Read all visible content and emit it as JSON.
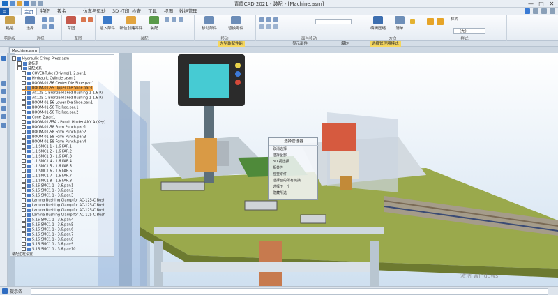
{
  "window": {
    "title": "青霞CAD 2021 - 装配 - [Machine.asm]",
    "controls": [
      "—",
      "□",
      "✕"
    ]
  },
  "menu_tabs": [
    {
      "label": "主页",
      "active": true
    },
    {
      "label": "特征",
      "active": false
    },
    {
      "label": "钣金",
      "active": false
    },
    {
      "label": "仿真与运动",
      "active": false
    },
    {
      "label": "3D 打印",
      "active": false
    },
    {
      "label": "检查",
      "active": false
    },
    {
      "label": "工具",
      "active": false
    },
    {
      "label": "视图",
      "active": false
    },
    {
      "label": "数据管理",
      "active": false
    }
  ],
  "ribbon": {
    "groups": [
      {
        "label": "剪贴板",
        "buttons": [
          "粘贴"
        ]
      },
      {
        "label": "选择",
        "buttons": [
          "选择"
        ]
      },
      {
        "label": "草图",
        "buttons": [
          "草图"
        ]
      },
      {
        "label": "装配",
        "buttons": [
          "插入部件",
          "新位创建零件",
          "装配"
        ]
      },
      {
        "label": "移动",
        "buttons": [
          "移动部件",
          "替换零件"
        ]
      },
      {
        "label": "面与移动",
        "buttons": []
      },
      {
        "label": "方向",
        "buttons": [
          "编辑压缩",
          "清单"
        ]
      },
      {
        "label": "样式",
        "buttons": [
          "样式"
        ]
      }
    ],
    "style_combo": "(无)"
  },
  "toolrow": {
    "items": [
      "大型装配性能",
      "显示部件",
      "爆炸",
      "选择管理器模式"
    ]
  },
  "document_tab": "Machine.asm",
  "tree": {
    "rows": [
      "Hydraulic Crimp Press.asm",
      "坐标系",
      "装配关系",
      "COVER-Tube (Driving(1_2.par:1",
      "Hydraulic Cylinder.asm:1",
      "BOOM-01-56 Center Die Shoe.par:1",
      "BOOM-01-55 Upper Die Shoe.par:1",
      "AC125-C Bronze Flaked Bushing 1-1.6 Ri",
      "AC125-C Bronze Flaked Bushing 1-1.6 Ri",
      "BOOM-01-56 Lower Die Shoe.par:1",
      "BOOM-01-56 Tie Rod.par:1",
      "BOOM-01-56 Tie Rod.par:2",
      "Cone_2.par:1",
      "BOOM-01-55A - Punch Holder ANY A (Key)",
      "BOOM-01-58 Form Punch.par:1",
      "BOOM-01-58 Form Punch.par:2",
      "BOOM-01-58 Form Punch.par:3",
      "BOOM-01-58 Form Punch.par:4",
      "1.1 SMC1 1 - 1.6 FAR.1",
      "1.1 SMC1 2 - 1.6 FAR.2",
      "1.1 SMC1 3 - 1.6 FAR.3",
      "1.1 SMC1 4 - 1.6 FAR.4",
      "1.1 SMC1 5 - 1.6 FAR.5",
      "1.1 SMC1 6 - 1.6 FAR.6",
      "1.1 SMC1 7 - 1.6 FAR.7",
      "1.1 SMC1 8 - 1.6 FAR.8",
      "5.16 SMC1 1 - 3.6.par:1",
      "5.16 SMC1 1 - 3.6.par:2",
      "5.16 SMC1 1 - 3.6.par:3",
      "Lamina Bushing Clamp for AC-125-C Bush",
      "Lamina Bushing Clamp for AC-125-C Bush",
      "Lamina Bushing Clamp for AC-125-C Bush",
      "Lamina Bushing Clamp for AC-125-C Bush",
      "5.16 SMC1 1 - 3.6.par:4",
      "5.16 SMC1 1 - 3.6.par:5",
      "5.16 SMC1 1 - 3.6.par:6",
      "5.16 SMC1 1 - 3.6.par:7",
      "5.16 SMC1 1 - 3.6.par:8",
      "5.16 SMC1 1 - 3.6.par:9",
      "5.16 SMC1 1 - 3.6.par:10"
    ],
    "selected_index": 6,
    "footer": "装配边框设置"
  },
  "context_menu": {
    "title": "选择管理器",
    "items": [
      "取消选择",
      "选择全部",
      "3D 视选择",
      "相关性",
      "检查零件",
      "选择面的所有链接",
      "选择下一个",
      "隐藏所选"
    ]
  },
  "status_bar": {
    "text": "提示条"
  },
  "watermark": "激活 Windows"
}
